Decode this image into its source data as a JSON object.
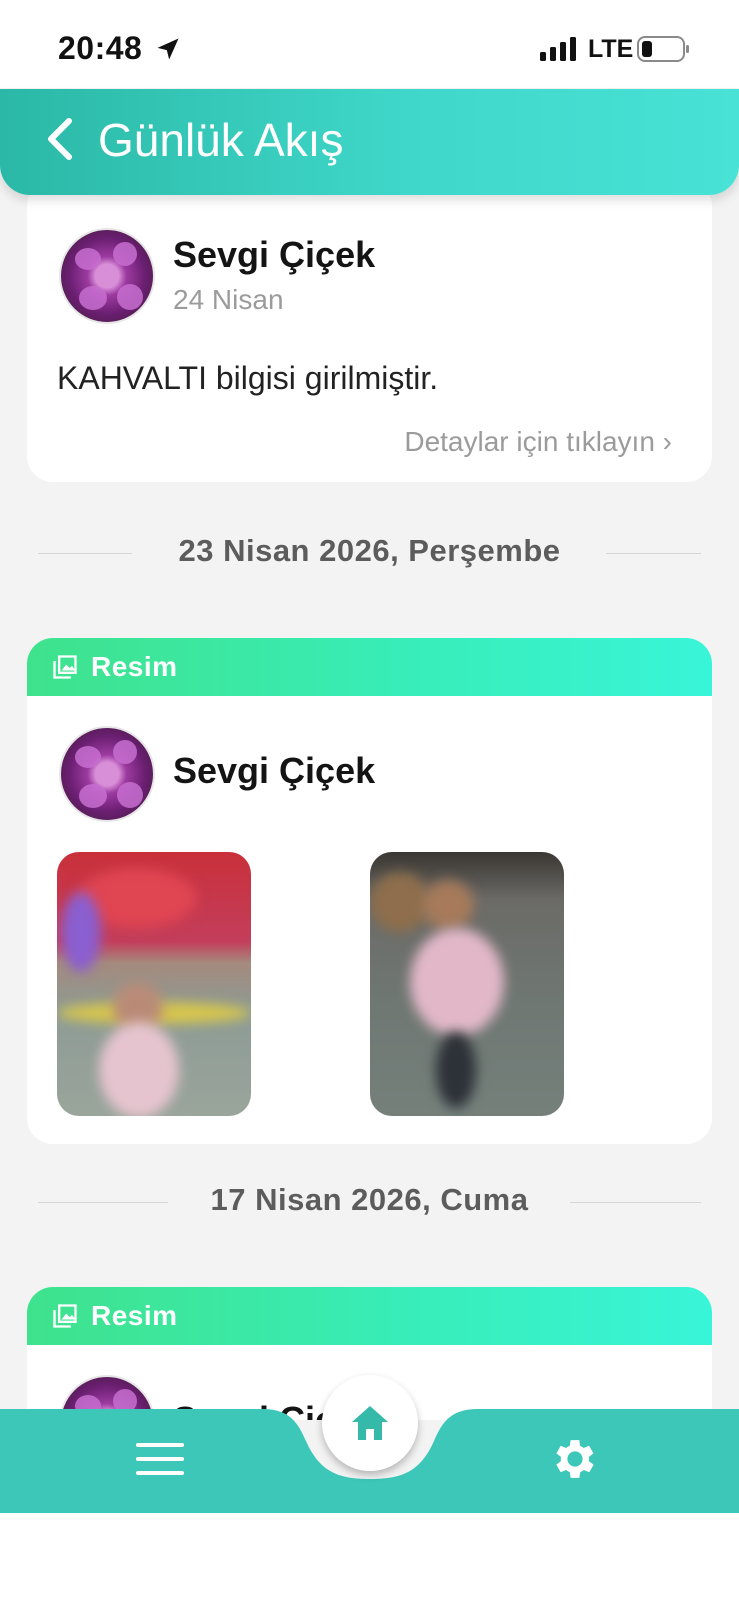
{
  "status_bar": {
    "time": "20:48",
    "network": "LTE"
  },
  "header": {
    "title": "Günlük Akış"
  },
  "feed": {
    "card1": {
      "name": "Sevgi Çiçek",
      "date": "24 Nisan",
      "text": "KAHVALTI bilgisi girilmiştir.",
      "link": "Detaylar için tıklayın ›"
    },
    "separator1": "23 Nisan 2026, Perşembe",
    "card2": {
      "badge": "Resim",
      "name": "Sevgi Çiçek"
    },
    "separator2": "17 Nisan 2026, Cuma",
    "card3": {
      "badge": "Resim",
      "name": "Sevgi Çiçek"
    }
  },
  "colors": {
    "header_start": "#2bb8a6",
    "header_end": "#48e2d6",
    "badge_start": "#3fe28c",
    "badge_end": "#39f5d8",
    "stripe_start": "#f99a5c",
    "stripe_end": "#f3647e",
    "nav": "#3cc7b8"
  },
  "icons": {
    "back": "chevron-left-icon",
    "badge": "image-icon",
    "menu": "hamburger-menu-icon",
    "home": "home-icon",
    "settings": "gear-icon"
  }
}
